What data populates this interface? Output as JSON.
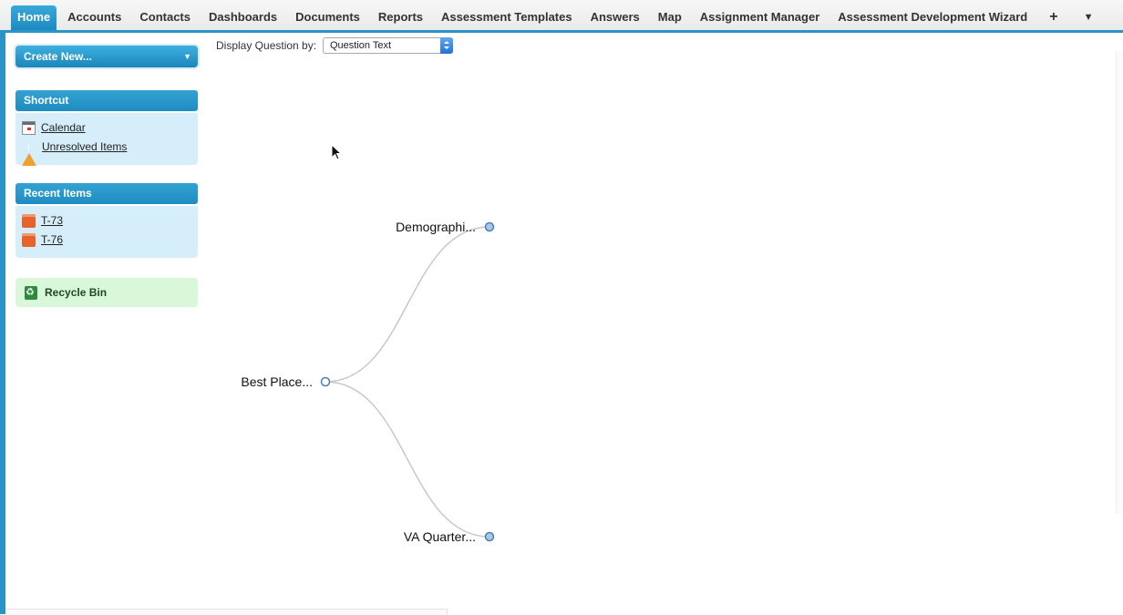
{
  "tabs": [
    {
      "label": "Home",
      "active": true
    },
    {
      "label": "Accounts"
    },
    {
      "label": "Contacts"
    },
    {
      "label": "Dashboards"
    },
    {
      "label": "Documents"
    },
    {
      "label": "Reports"
    },
    {
      "label": "Assessment Templates"
    },
    {
      "label": "Answers"
    },
    {
      "label": "Map"
    },
    {
      "label": "Assignment Manager"
    },
    {
      "label": "Assessment Development Wizard"
    }
  ],
  "tab_plus_label": "+",
  "tab_more_label": "▼",
  "sidebar": {
    "create_new": "Create New...",
    "shortcut": {
      "title": "Shortcut",
      "items": [
        {
          "label": "Calendar",
          "icon": "calendar-icon"
        },
        {
          "label": "Unresolved Items",
          "icon": "warning-icon"
        }
      ]
    },
    "recent": {
      "title": "Recent Items",
      "items": [
        {
          "label": "T-73",
          "icon": "record-icon"
        },
        {
          "label": "T-76",
          "icon": "record-icon"
        }
      ]
    },
    "recycle_bin": "Recycle Bin"
  },
  "display": {
    "label": "Display Question by:",
    "selected": "Question Text"
  },
  "tree": {
    "root": "Best Place...",
    "children": [
      "Demographi...",
      "VA Quarter..."
    ]
  },
  "colors": {
    "accent": "#2a94c6",
    "panel_bg": "#d6eefa",
    "recycle_bg": "#d9f7d9",
    "node_fill": "#a9c8e6",
    "node_stroke": "#4a7fb0"
  }
}
